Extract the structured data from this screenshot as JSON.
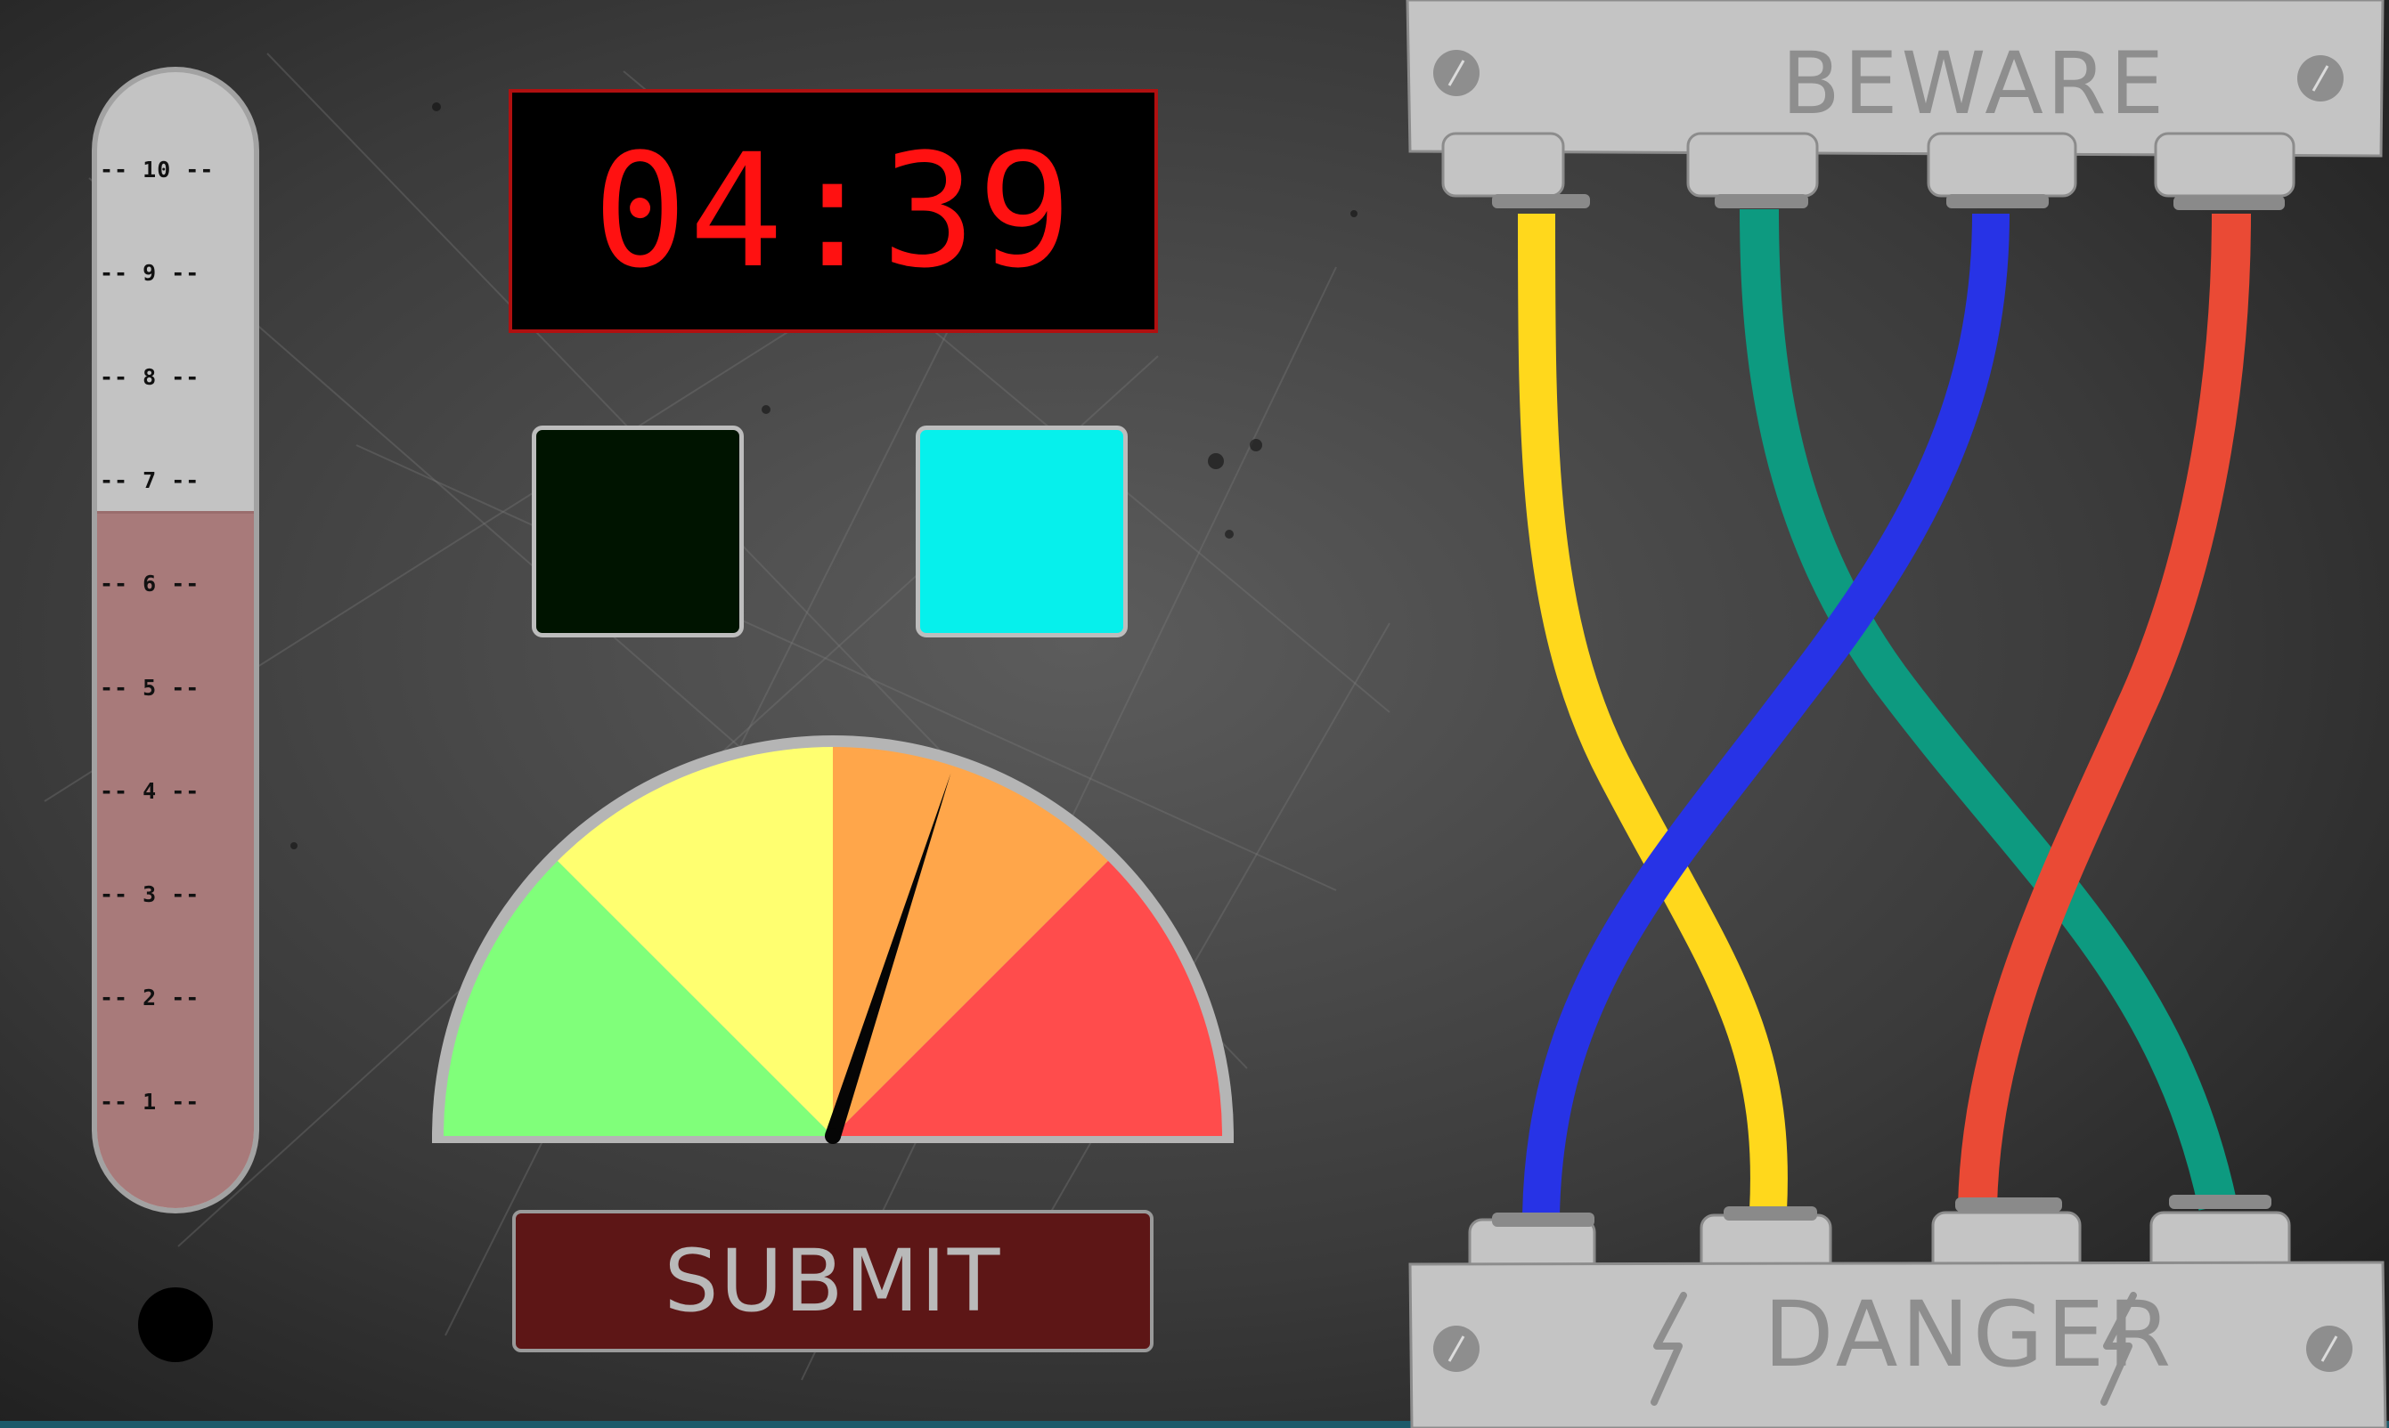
{
  "thermometer": {
    "ticks": [
      "-- 10 --",
      "-- 9 --",
      "-- 8 --",
      "-- 7 --",
      "-- 6 --",
      "-- 5 --",
      "-- 4 --",
      "-- 3 --",
      "-- 2 --",
      "-- 1 --"
    ],
    "fill_level": 6.7,
    "fill_color": "#a87a7a"
  },
  "timer": {
    "display": "04:39",
    "color": "#ff1111"
  },
  "color_squares": {
    "left_color": "#001400",
    "right_color": "#06f0ec"
  },
  "gauge": {
    "segments": [
      "#80ff7a",
      "#ffff70",
      "#ffa64a",
      "#ff4c4c"
    ],
    "needle_fraction": 0.6
  },
  "submit": {
    "label": "SUBMIT"
  },
  "wire_panel": {
    "top_label": "BEWARE",
    "bottom_label": "DANGER",
    "wire_colors": [
      "#ffd81c",
      "#0d9a80",
      "#2733e6",
      "#ea4a35"
    ]
  }
}
